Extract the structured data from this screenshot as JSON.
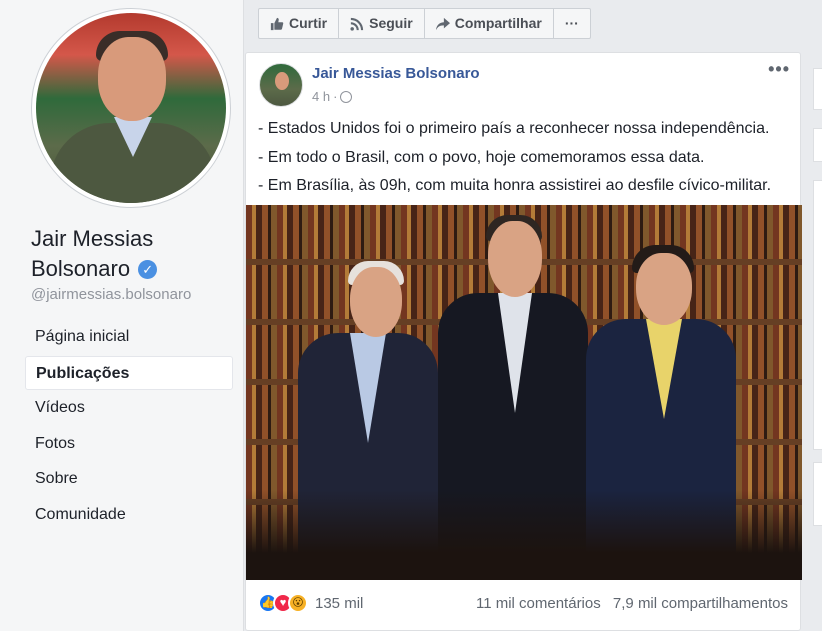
{
  "sidebar": {
    "page_name": "Jair Messias Bolsonaro",
    "handle": "@jairmessias.bolsonaro",
    "verified_icon": "check-icon",
    "nav": [
      {
        "label": "Página inicial",
        "active": false
      },
      {
        "label": "Publicações",
        "active": true
      },
      {
        "label": "Vídeos",
        "active": false
      },
      {
        "label": "Fotos",
        "active": false
      },
      {
        "label": "Sobre",
        "active": false
      },
      {
        "label": "Comunidade",
        "active": false
      }
    ]
  },
  "actions": {
    "like": "Curtir",
    "follow": "Seguir",
    "share": "Compartilhar",
    "more": "···"
  },
  "post": {
    "author": "Jair Messias Bolsonaro",
    "time": "4 h",
    "separator": "·",
    "more": "•••",
    "lines": [
      "- Estados Unidos foi o primeiro país a reconhecer nossa independência.",
      "- Em todo o Brasil, com o povo, hoje comemoramos essa data.",
      "- Em Brasília, às 09h, com muita honra assistirei ao desfile cívico-militar."
    ],
    "reactions_count": "135 mil",
    "comments": "11 mil comentários",
    "shares": "7,9 mil compartilhamentos"
  },
  "colors": {
    "link_blue": "#385898",
    "verified_blue": "#4a90e2",
    "background": "#e9ebee"
  }
}
